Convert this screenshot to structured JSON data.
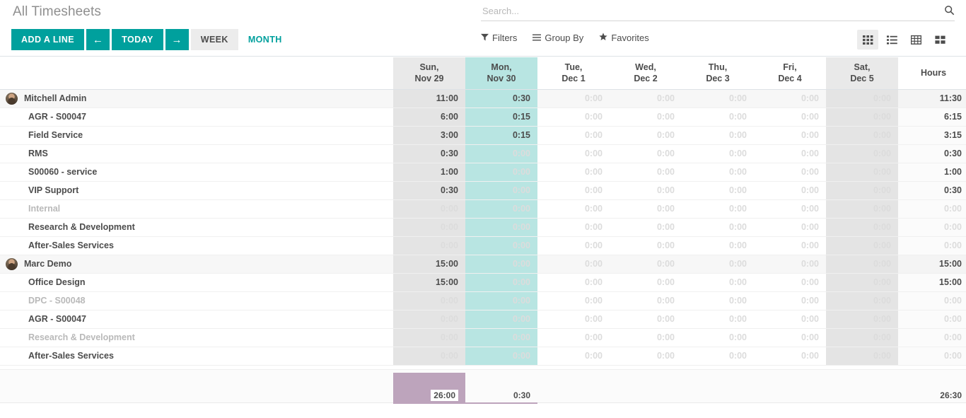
{
  "header": {
    "title": "All Timesheets",
    "add_line_label": "ADD A LINE",
    "prev_label": "←",
    "today_label": "TODAY",
    "next_label": "→",
    "week_label": "WEEK",
    "month_label": "MONTH"
  },
  "search": {
    "placeholder": "Search...",
    "value": "",
    "icon": "search-icon"
  },
  "filters": {
    "filters_label": "Filters",
    "filters_icon": "funnel-icon",
    "group_by_label": "Group By",
    "group_by_icon": "hamburger-icon",
    "favorites_label": "Favorites",
    "favorites_icon": "star-icon"
  },
  "views": [
    {
      "name": "grid-view-icon",
      "active": true
    },
    {
      "name": "list-view-icon",
      "active": false
    },
    {
      "name": "pivot-view-icon",
      "active": false
    },
    {
      "name": "kanban-view-icon",
      "active": false
    }
  ],
  "colors": {
    "brand_teal": "#00a09d",
    "today_highlight": "#b8e5e2",
    "weekend_shade": "#e4e4e4",
    "total_bar": "#bda4bc",
    "zero_text": "#dcdcdc"
  },
  "table": {
    "label_column_header": "",
    "columns": [
      {
        "dow": "Sun,",
        "date": "Nov 29",
        "weekend": true,
        "today": false
      },
      {
        "dow": "Mon,",
        "date": "Nov 30",
        "weekend": false,
        "today": true
      },
      {
        "dow": "Tue,",
        "date": "Dec 1",
        "weekend": false,
        "today": false
      },
      {
        "dow": "Wed,",
        "date": "Dec 2",
        "weekend": false,
        "today": false
      },
      {
        "dow": "Thu,",
        "date": "Dec 3",
        "weekend": false,
        "today": false
      },
      {
        "dow": "Fri,",
        "date": "Dec 4",
        "weekend": false,
        "today": false
      },
      {
        "dow": "Sat,",
        "date": "Dec 5",
        "weekend": true,
        "today": false
      }
    ],
    "hours_header": "Hours",
    "rows": [
      {
        "type": "group",
        "label": "Mitchell Admin",
        "avatar": true,
        "dim": false,
        "values": [
          "11:00",
          "0:30",
          "0:00",
          "0:00",
          "0:00",
          "0:00",
          "0:00"
        ],
        "total": "11:30"
      },
      {
        "type": "child",
        "label": "AGR - S00047",
        "avatar": false,
        "dim": false,
        "values": [
          "6:00",
          "0:15",
          "0:00",
          "0:00",
          "0:00",
          "0:00",
          "0:00"
        ],
        "total": "6:15"
      },
      {
        "type": "child",
        "label": "Field Service",
        "avatar": false,
        "dim": false,
        "values": [
          "3:00",
          "0:15",
          "0:00",
          "0:00",
          "0:00",
          "0:00",
          "0:00"
        ],
        "total": "3:15"
      },
      {
        "type": "child",
        "label": "RMS",
        "avatar": false,
        "dim": false,
        "values": [
          "0:30",
          "0:00",
          "0:00",
          "0:00",
          "0:00",
          "0:00",
          "0:00"
        ],
        "total": "0:30"
      },
      {
        "type": "child",
        "label": "S00060 - service",
        "avatar": false,
        "dim": false,
        "values": [
          "1:00",
          "0:00",
          "0:00",
          "0:00",
          "0:00",
          "0:00",
          "0:00"
        ],
        "total": "1:00"
      },
      {
        "type": "child",
        "label": "VIP Support",
        "avatar": false,
        "dim": false,
        "values": [
          "0:30",
          "0:00",
          "0:00",
          "0:00",
          "0:00",
          "0:00",
          "0:00"
        ],
        "total": "0:30"
      },
      {
        "type": "child",
        "label": "Internal",
        "avatar": false,
        "dim": true,
        "values": [
          "0:00",
          "0:00",
          "0:00",
          "0:00",
          "0:00",
          "0:00",
          "0:00"
        ],
        "total": "0:00"
      },
      {
        "type": "child",
        "label": "Research & Development",
        "avatar": false,
        "dim": false,
        "values": [
          "0:00",
          "0:00",
          "0:00",
          "0:00",
          "0:00",
          "0:00",
          "0:00"
        ],
        "total": "0:00"
      },
      {
        "type": "child",
        "label": "After-Sales Services",
        "avatar": false,
        "dim": false,
        "values": [
          "0:00",
          "0:00",
          "0:00",
          "0:00",
          "0:00",
          "0:00",
          "0:00"
        ],
        "total": "0:00"
      },
      {
        "type": "group",
        "label": "Marc Demo",
        "avatar": true,
        "dim": false,
        "values": [
          "15:00",
          "0:00",
          "0:00",
          "0:00",
          "0:00",
          "0:00",
          "0:00"
        ],
        "total": "15:00"
      },
      {
        "type": "child",
        "label": "Office Design",
        "avatar": false,
        "dim": false,
        "values": [
          "15:00",
          "0:00",
          "0:00",
          "0:00",
          "0:00",
          "0:00",
          "0:00"
        ],
        "total": "15:00"
      },
      {
        "type": "child",
        "label": "DPC - S00048",
        "avatar": false,
        "dim": true,
        "values": [
          "0:00",
          "0:00",
          "0:00",
          "0:00",
          "0:00",
          "0:00",
          "0:00"
        ],
        "total": "0:00"
      },
      {
        "type": "child",
        "label": "AGR - S00047",
        "avatar": false,
        "dim": false,
        "values": [
          "0:00",
          "0:00",
          "0:00",
          "0:00",
          "0:00",
          "0:00",
          "0:00"
        ],
        "total": "0:00"
      },
      {
        "type": "child",
        "label": "Research & Development",
        "avatar": false,
        "dim": true,
        "values": [
          "0:00",
          "0:00",
          "0:00",
          "0:00",
          "0:00",
          "0:00",
          "0:00"
        ],
        "total": "0:00"
      },
      {
        "type": "child",
        "label": "After-Sales Services",
        "avatar": false,
        "dim": false,
        "values": [
          "0:00",
          "0:00",
          "0:00",
          "0:00",
          "0:00",
          "0:00",
          "0:00"
        ],
        "total": "0:00"
      }
    ]
  },
  "chart_data": {
    "type": "bar",
    "title": "Weekly timesheet totals per day",
    "categories": [
      "Sun, Nov 29",
      "Mon, Nov 30",
      "Tue, Dec 1",
      "Wed, Dec 2",
      "Thu, Dec 3",
      "Fri, Dec 4",
      "Sat, Dec 5"
    ],
    "labels": [
      "26:00",
      "0:30",
      "",
      "",
      "",
      "",
      ""
    ],
    "values": [
      26.0,
      0.5,
      0,
      0,
      0,
      0,
      0
    ],
    "ylabel": "Hours",
    "ylim": [
      0,
      26
    ],
    "grand_total": "26:30",
    "bar_color": "#bda4bc"
  }
}
